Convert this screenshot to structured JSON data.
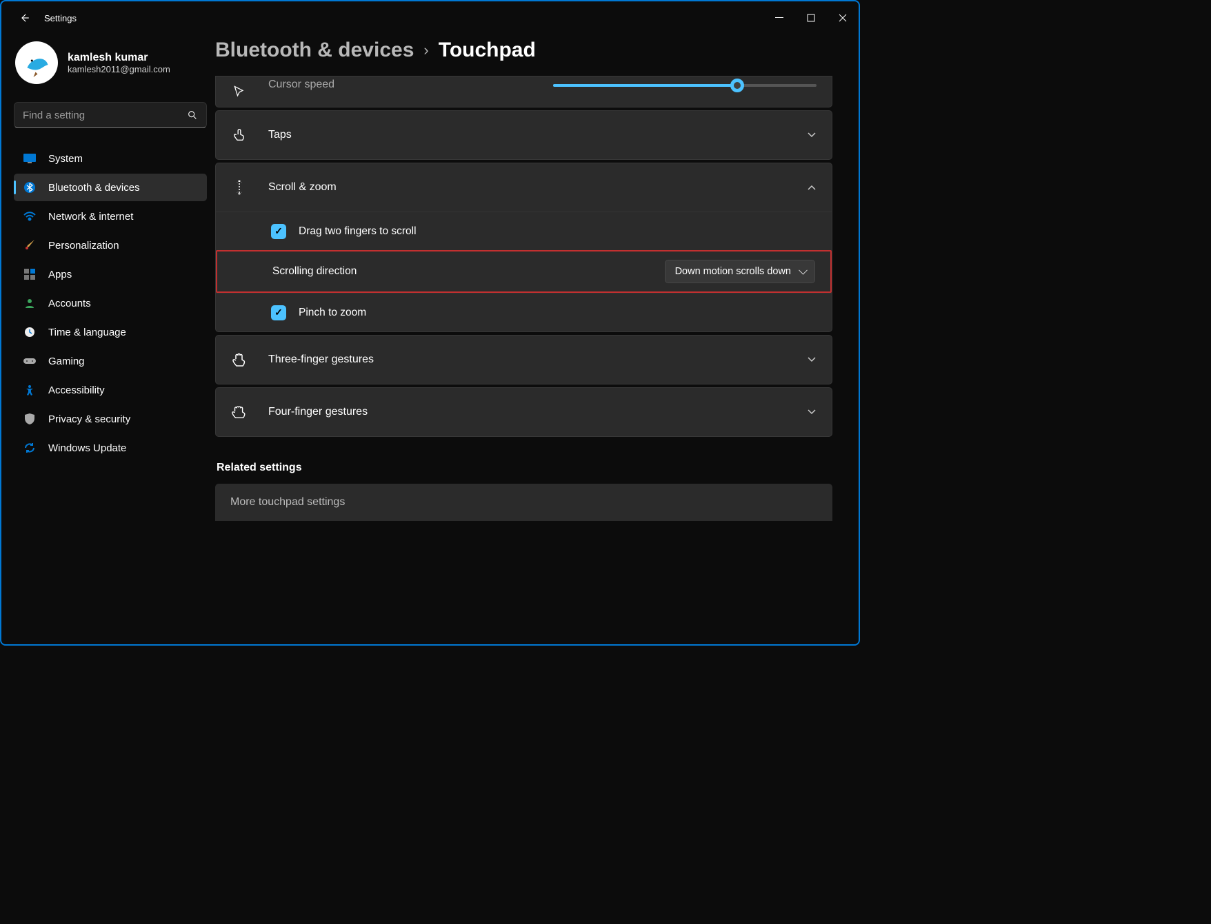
{
  "app_title": "Settings",
  "profile": {
    "name": "kamlesh kumar",
    "email": "kamlesh2011@gmail.com"
  },
  "search": {
    "placeholder": "Find a setting"
  },
  "sidebar": {
    "items": [
      {
        "label": "System"
      },
      {
        "label": "Bluetooth & devices"
      },
      {
        "label": "Network & internet"
      },
      {
        "label": "Personalization"
      },
      {
        "label": "Apps"
      },
      {
        "label": "Accounts"
      },
      {
        "label": "Time & language"
      },
      {
        "label": "Gaming"
      },
      {
        "label": "Accessibility"
      },
      {
        "label": "Privacy & security"
      },
      {
        "label": "Windows Update"
      }
    ]
  },
  "breadcrumb": {
    "parent": "Bluetooth & devices",
    "current": "Touchpad"
  },
  "panels": {
    "cursor_speed": "Cursor speed",
    "taps": "Taps",
    "scroll_zoom": {
      "title": "Scroll & zoom",
      "drag_two": "Drag two fingers to scroll",
      "direction_label": "Scrolling direction",
      "direction_value": "Down motion scrolls down",
      "pinch": "Pinch to zoom"
    },
    "three_finger": "Three-finger gestures",
    "four_finger": "Four-finger gestures"
  },
  "related": {
    "heading": "Related settings",
    "more": "More touchpad settings"
  }
}
